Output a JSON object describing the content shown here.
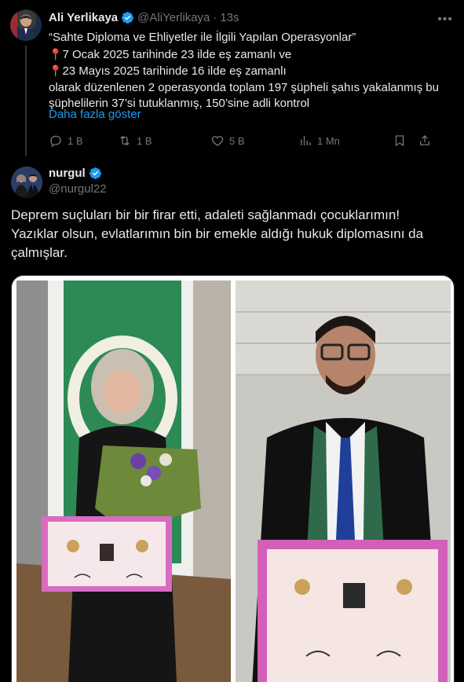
{
  "quoted_tweet": {
    "name": "Ali Yerlikaya",
    "handle": "@AliYerlikaya",
    "separator": "·",
    "time": "13s",
    "lines": [
      "“Sahte Diploma ve Ehliyetler ile İlgili Yapılan Operasyonlar”",
      "7 Ocak 2025 tarihinde 23 ilde eş zamanlı ve",
      "23 Mayıs 2025 tarihinde 16 ilde eş zamanlı",
      "olarak düzenlenen 2 operasyonda toplam 197 şüpheli şahıs yakalanmış bu",
      "şüphelilerin 37’si tutuklanmış, 150’sine adli kontrol"
    ],
    "show_more": "Daha fazla göster",
    "stats": {
      "replies": "1 B",
      "reposts": "1 B",
      "likes": "5 B",
      "views": "1 Mn"
    },
    "pin_icon": "round-pushpin-icon",
    "colors": {
      "verified": "#1d9bf0",
      "link": "#1d9bf0",
      "pin": "#e0245e"
    }
  },
  "main_tweet": {
    "name": "nurgul",
    "handle": "@nurgul22",
    "lines": [
      "Deprem suçluları bir bir firar etti, adaleti sağlanmadı çocuklarımın!",
      "Yazıklar olsun, evlatlarımın bin bir emekle aldığı hukuk diplomasını da",
      "çalmışlar."
    ],
    "media": [
      {
        "alt": "graduate-woman-with-diploma-and-flowers"
      },
      {
        "alt": "graduate-man-in-lawyer-robe-with-diploma"
      }
    ]
  }
}
